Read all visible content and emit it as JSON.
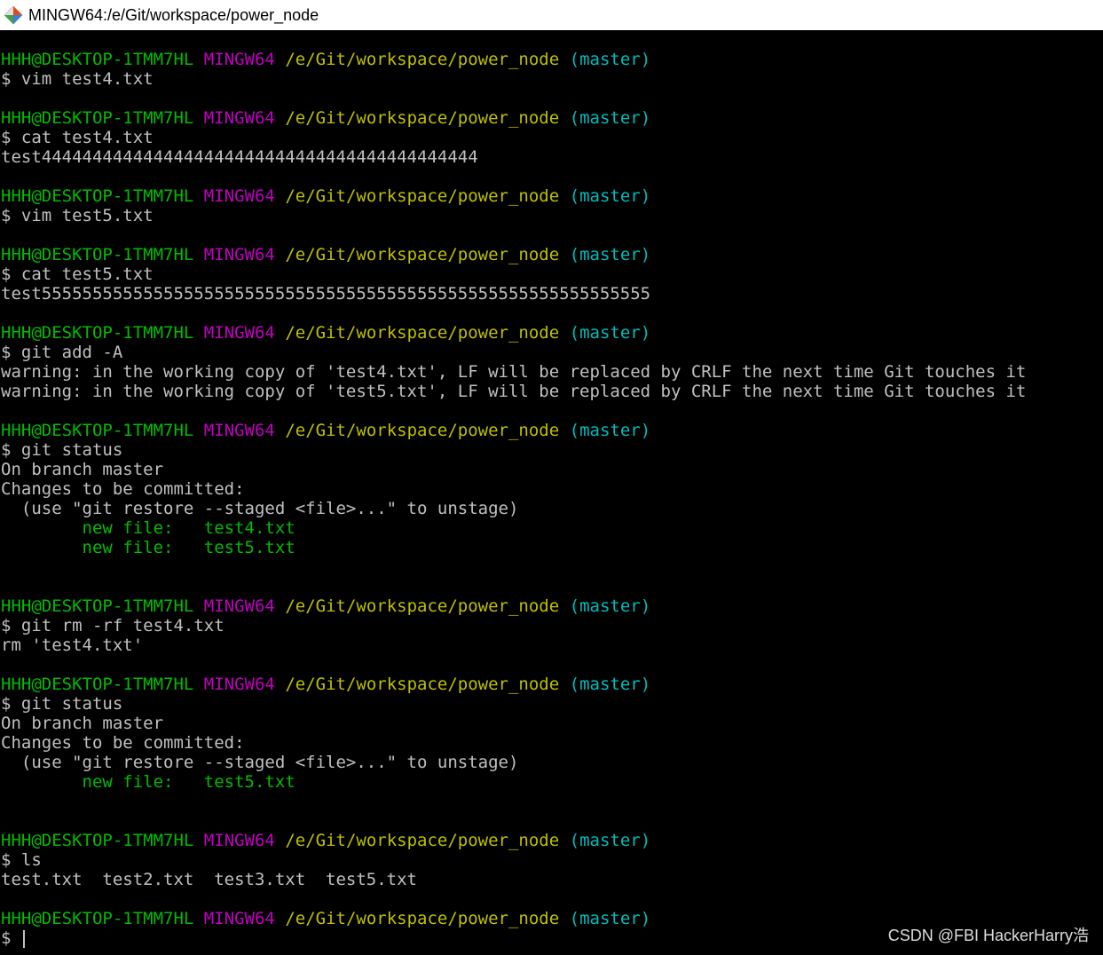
{
  "window": {
    "title": "MINGW64:/e/Git/workspace/power_node",
    "icon": "git-bash-icon"
  },
  "prompt": {
    "user_host": "HHH@DESKTOP-1TMM7HL",
    "system": "MINGW64",
    "path": "/e/Git/workspace/power_node",
    "branch": "(master)"
  },
  "colors": {
    "background": "#000000",
    "text": "#c0c0c0",
    "user_host": "#00bb00",
    "system": "#bf00bf",
    "path": "#bfbf00",
    "branch": "#00bbbb",
    "staged_file": "#00bb00"
  },
  "lines": [
    {
      "type": "prompt"
    },
    {
      "type": "text",
      "text": "$ vim test4.txt"
    },
    {
      "type": "blank"
    },
    {
      "type": "prompt"
    },
    {
      "type": "text",
      "text": "$ cat test4.txt"
    },
    {
      "type": "text",
      "text": "test4444444444444444444444444444444444444444444"
    },
    {
      "type": "blank"
    },
    {
      "type": "prompt"
    },
    {
      "type": "text",
      "text": "$ vim test5.txt"
    },
    {
      "type": "blank"
    },
    {
      "type": "prompt"
    },
    {
      "type": "text",
      "text": "$ cat test5.txt"
    },
    {
      "type": "text",
      "text": "test555555555555555555555555555555555555555555555555555555555555"
    },
    {
      "type": "blank"
    },
    {
      "type": "prompt"
    },
    {
      "type": "text",
      "text": "$ git add -A"
    },
    {
      "type": "text",
      "text": "warning: in the working copy of 'test4.txt', LF will be replaced by CRLF the next time Git touches it"
    },
    {
      "type": "text",
      "text": "warning: in the working copy of 'test5.txt', LF will be replaced by CRLF the next time Git touches it"
    },
    {
      "type": "blank"
    },
    {
      "type": "prompt"
    },
    {
      "type": "text",
      "text": "$ git status"
    },
    {
      "type": "text",
      "text": "On branch master"
    },
    {
      "type": "text",
      "text": "Changes to be committed:"
    },
    {
      "type": "text",
      "text": "  (use \"git restore --staged <file>...\" to unstage)"
    },
    {
      "type": "green",
      "text": "        new file:   test4.txt"
    },
    {
      "type": "green",
      "text": "        new file:   test5.txt"
    },
    {
      "type": "blank"
    },
    {
      "type": "blank"
    },
    {
      "type": "prompt"
    },
    {
      "type": "text",
      "text": "$ git rm -rf test4.txt"
    },
    {
      "type": "text",
      "text": "rm 'test4.txt'"
    },
    {
      "type": "blank"
    },
    {
      "type": "prompt"
    },
    {
      "type": "text",
      "text": "$ git status"
    },
    {
      "type": "text",
      "text": "On branch master"
    },
    {
      "type": "text",
      "text": "Changes to be committed:"
    },
    {
      "type": "text",
      "text": "  (use \"git restore --staged <file>...\" to unstage)"
    },
    {
      "type": "green",
      "text": "        new file:   test5.txt"
    },
    {
      "type": "blank"
    },
    {
      "type": "blank"
    },
    {
      "type": "prompt"
    },
    {
      "type": "text",
      "text": "$ ls"
    },
    {
      "type": "text",
      "text": "test.txt  test2.txt  test3.txt  test5.txt"
    },
    {
      "type": "blank"
    },
    {
      "type": "prompt"
    },
    {
      "type": "input",
      "text": "$ "
    }
  ],
  "watermark": "CSDN @FBI HackerHarry浩"
}
